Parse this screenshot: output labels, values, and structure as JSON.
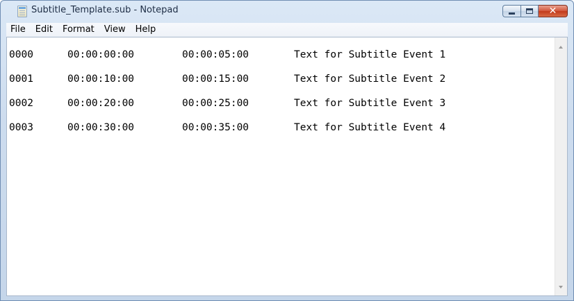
{
  "window": {
    "title": "Subtitle_Template.sub - Notepad",
    "app_icon": "notepad-icon"
  },
  "caption_buttons": {
    "minimize_icon": "minimize-icon",
    "maximize_icon": "maximize-icon",
    "close_icon": "close-icon",
    "close_glyph": "✕"
  },
  "menu": {
    "items": [
      {
        "label": "File"
      },
      {
        "label": "Edit"
      },
      {
        "label": "Format"
      },
      {
        "label": "View"
      },
      {
        "label": "Help"
      }
    ]
  },
  "editor": {
    "lines": [
      {
        "id": "0000",
        "start": "00:00:00:00",
        "end": "00:00:05:00",
        "text": "Text for Subtitle Event 1"
      },
      {
        "id": "0001",
        "start": "00:00:10:00",
        "end": "00:00:15:00",
        "text": "Text for Subtitle Event 2"
      },
      {
        "id": "0002",
        "start": "00:00:20:00",
        "end": "00:00:25:00",
        "text": "Text for Subtitle Event 3"
      },
      {
        "id": "0003",
        "start": "00:00:30:00",
        "end": "00:00:35:00",
        "text": "Text for Subtitle Event 4"
      }
    ]
  },
  "scrollbar": {
    "up_icon": "scroll-up-arrow-icon",
    "down_icon": "scroll-down-arrow-icon"
  }
}
